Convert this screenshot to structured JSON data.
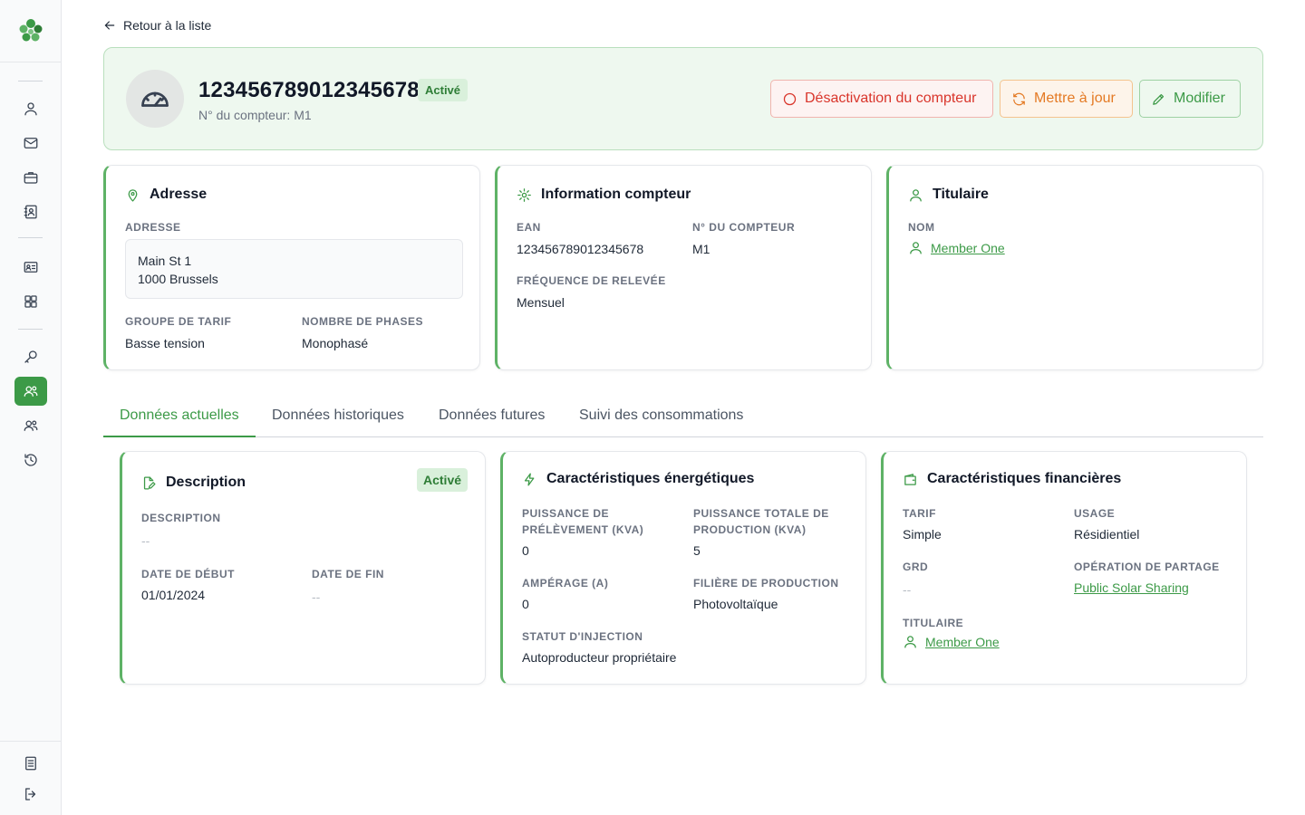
{
  "sidebar": {
    "icons": [
      "logo-icon",
      "user-icon",
      "mail-icon",
      "briefcase-icon",
      "contacts-icon",
      "id-card-icon",
      "grid-icon",
      "search-key-icon",
      "members-icon",
      "group-icon",
      "history-icon",
      "document-icon",
      "logout-icon"
    ],
    "active": "members-icon",
    "accent": "#3c9a47"
  },
  "back_link": {
    "label": "Retour à la liste"
  },
  "header": {
    "meter_id": "123456789012345678",
    "status": "Activé",
    "subtitle": "N° du compteur: M1",
    "buttons": {
      "deactivate": "Désactivation du compteur",
      "update": "Mettre à jour",
      "edit": "Modifier"
    }
  },
  "address_card": {
    "title": "Adresse",
    "address_label": "ADRESSE",
    "address_line1": "Main St 1",
    "address_line2": "1000 Brussels",
    "tariff_label": "GROUPE DE TARIF",
    "tariff_value": "Basse tension",
    "phases_label": "NOMBRE DE PHASES",
    "phases_value": "Monophasé"
  },
  "meter_card": {
    "title": "Information compteur",
    "ean_label": "EAN",
    "ean_value": "123456789012345678",
    "number_label": "N° DU COMPTEUR",
    "number_value": "M1",
    "frequency_label": "FRÉQUENCE DE RELEVÉE",
    "frequency_value": "Mensuel"
  },
  "holder_card": {
    "title": "Titulaire",
    "name_label": "NOM",
    "name_value": "Member One"
  },
  "tabs": [
    {
      "label": "Données actuelles",
      "active": true
    },
    {
      "label": "Données historiques",
      "active": false
    },
    {
      "label": "Données futures",
      "active": false
    },
    {
      "label": "Suivi des consommations",
      "active": false
    }
  ],
  "description_card": {
    "title": "Description",
    "status": "Activé",
    "description_label": "DESCRIPTION",
    "description_value": "--",
    "start_label": "DATE DE DÉBUT",
    "start_value": "01/01/2024",
    "end_label": "DATE DE FIN",
    "end_value": "--"
  },
  "energy_card": {
    "title": "Caractéristiques énergétiques",
    "draw_power_label_1": "PUISSANCE DE",
    "draw_power_label_2": "PRÉLÈVEMENT (KVA)",
    "draw_power_value": "0",
    "prod_power_label_1": "PUISSANCE TOTALE DE",
    "prod_power_label_2": "PRODUCTION (KVA)",
    "prod_power_value": "5",
    "amperage_label": "AMPÉRAGE (A)",
    "amperage_value": "0",
    "production_label": "FILIÈRE DE PRODUCTION",
    "production_value": "Photovoltaïque",
    "injection_label": "STATUT D'INJECTION",
    "injection_value": "Autoproducteur propriétaire"
  },
  "finance_card": {
    "title": "Caractéristiques financières",
    "tariff_label": "TARIF",
    "tariff_value": "Simple",
    "usage_label": "USAGE",
    "usage_value": "Résidientiel",
    "grd_label": "GRD",
    "grd_value": "--",
    "sharing_label": "OPÉRATION DE PARTAGE",
    "sharing_value": "Public Solar Sharing",
    "holder_label": "TITULAIRE",
    "holder_value": "Member One"
  }
}
